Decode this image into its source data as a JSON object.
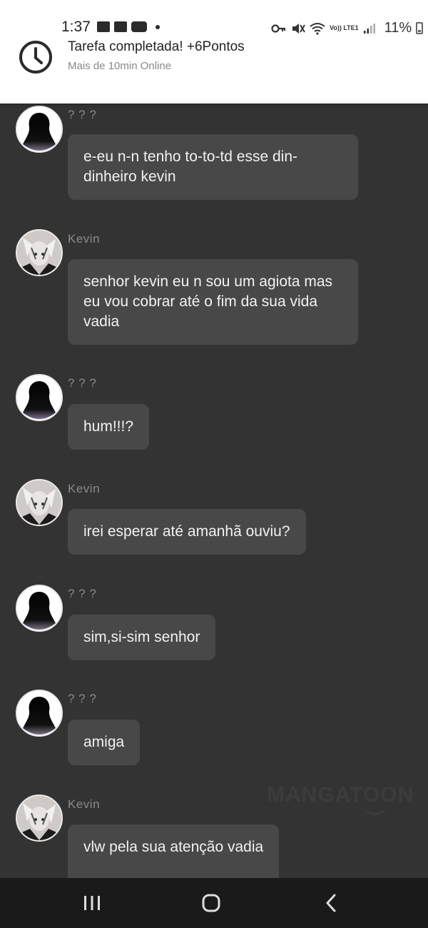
{
  "status_bar": {
    "time": "1:37",
    "network": "Vo)) LTE1",
    "battery": "11%"
  },
  "notification": {
    "title": "Tarefa completada! +6Pontos",
    "subtitle": "Mais de 10min Online",
    "icon": "clock-icon"
  },
  "messages": [
    {
      "sender": "? ? ?",
      "avatar": "shadow-avatar",
      "text": "e-eu n-n tenho to-to-td esse din-dinheiro kevin"
    },
    {
      "sender": "Kevin",
      "avatar": "kevin-avatar",
      "text": "senhor kevin eu n sou um agiota mas eu vou cobrar até o fim da sua vida vadia"
    },
    {
      "sender": "? ? ?",
      "avatar": "shadow-avatar",
      "text": "hum!!!?"
    },
    {
      "sender": "Kevin",
      "avatar": "kevin-avatar",
      "text": "irei esperar até amanhã ouviu?"
    },
    {
      "sender": "? ? ?",
      "avatar": "shadow-avatar",
      "text": "sim,si-sim senhor"
    },
    {
      "sender": "? ? ?",
      "avatar": "shadow-avatar",
      "text": "amiga"
    },
    {
      "sender": "Kevin",
      "avatar": "kevin-avatar",
      "text": "vlw pela sua atenção vadia"
    }
  ],
  "watermark": "MANGATOON",
  "nav": {
    "buttons": [
      "recents-icon",
      "home-icon",
      "back-icon"
    ]
  },
  "colors": {
    "chat_background": "#333333",
    "bubble": "#484848",
    "nav_background": "#1a1a1a"
  }
}
